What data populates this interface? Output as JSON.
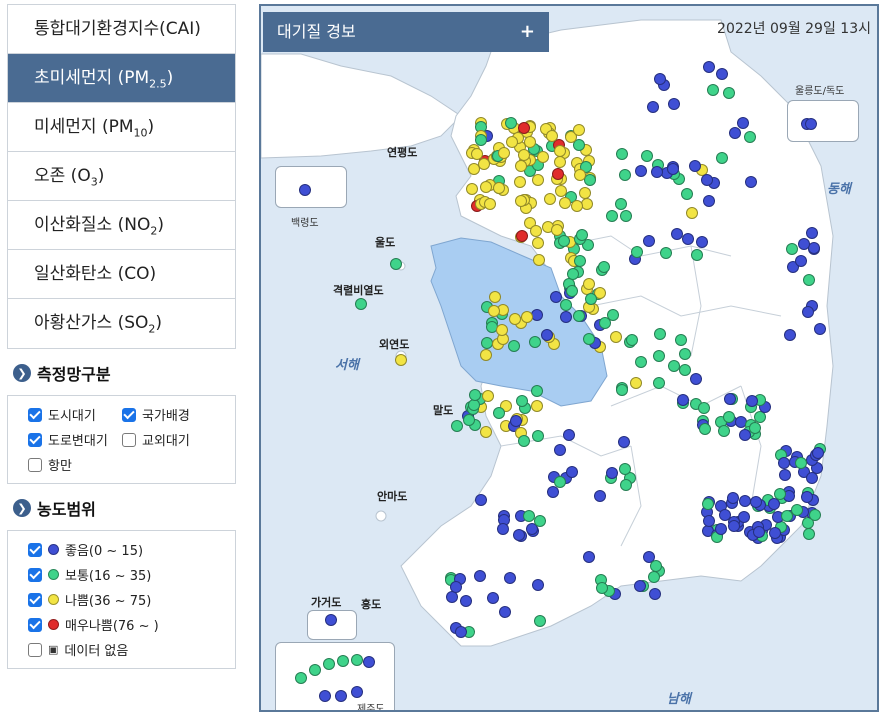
{
  "menu": [
    {
      "main": "통합대기환경지수(CAI)",
      "sub": "",
      "tail": ""
    },
    {
      "main": "초미세먼지 (PM",
      "sub": "2.5",
      "tail": ")",
      "active": true
    },
    {
      "main": "미세먼지 (PM",
      "sub": "10",
      "tail": ")"
    },
    {
      "main": "오존 (O",
      "sub": "3",
      "tail": ")"
    },
    {
      "main": "이산화질소 (NO",
      "sub": "2",
      "tail": ")"
    },
    {
      "main": "일산화탄소 (CO)",
      "sub": "",
      "tail": ""
    },
    {
      "main": "아황산가스 (SO",
      "sub": "2",
      "tail": ")"
    }
  ],
  "network": {
    "title": "측정망구분",
    "items": [
      {
        "label": "도시대기",
        "checked": true
      },
      {
        "label": "국가배경",
        "checked": true
      },
      {
        "label": "도로변대기",
        "checked": true
      },
      {
        "label": "교외대기",
        "checked": false
      },
      {
        "label": "항만",
        "checked": false
      }
    ]
  },
  "range": {
    "title": "농도범위",
    "items": [
      {
        "label": "좋음(0 ~ 15)",
        "checked": true,
        "color": "#3f4fd4"
      },
      {
        "label": "보통(16 ~ 35)",
        "checked": true,
        "color": "#3fd38a"
      },
      {
        "label": "나쁨(36 ~ 75)",
        "checked": true,
        "color": "#f2e444"
      },
      {
        "label": "매우나쁨(76 ~ )",
        "checked": true,
        "color": "#e02c2c"
      },
      {
        "label": "데이터 없음",
        "checked": false,
        "color": "nodata"
      }
    ]
  },
  "map": {
    "tab_title": "대기질 경보",
    "plus": "+",
    "timestamp": "2022년 09월 29일 13시",
    "colors": {
      "land": "#ffffff",
      "sea": "#dce8f4",
      "alert": "#a9cdf2",
      "border": "#b8c4d0",
      "good": "#3f4fd4",
      "normal": "#3fd38a",
      "bad": "#f2e444",
      "very_bad": "#e02c2c"
    },
    "places": [
      "연평도",
      "울도",
      "격렬비열도",
      "외연도",
      "말도",
      "안마도",
      "가거도",
      "흥도",
      "백령도",
      "울릉도/독도",
      "제주도"
    ],
    "seas": [
      "서해",
      "동해",
      "남해"
    ]
  }
}
